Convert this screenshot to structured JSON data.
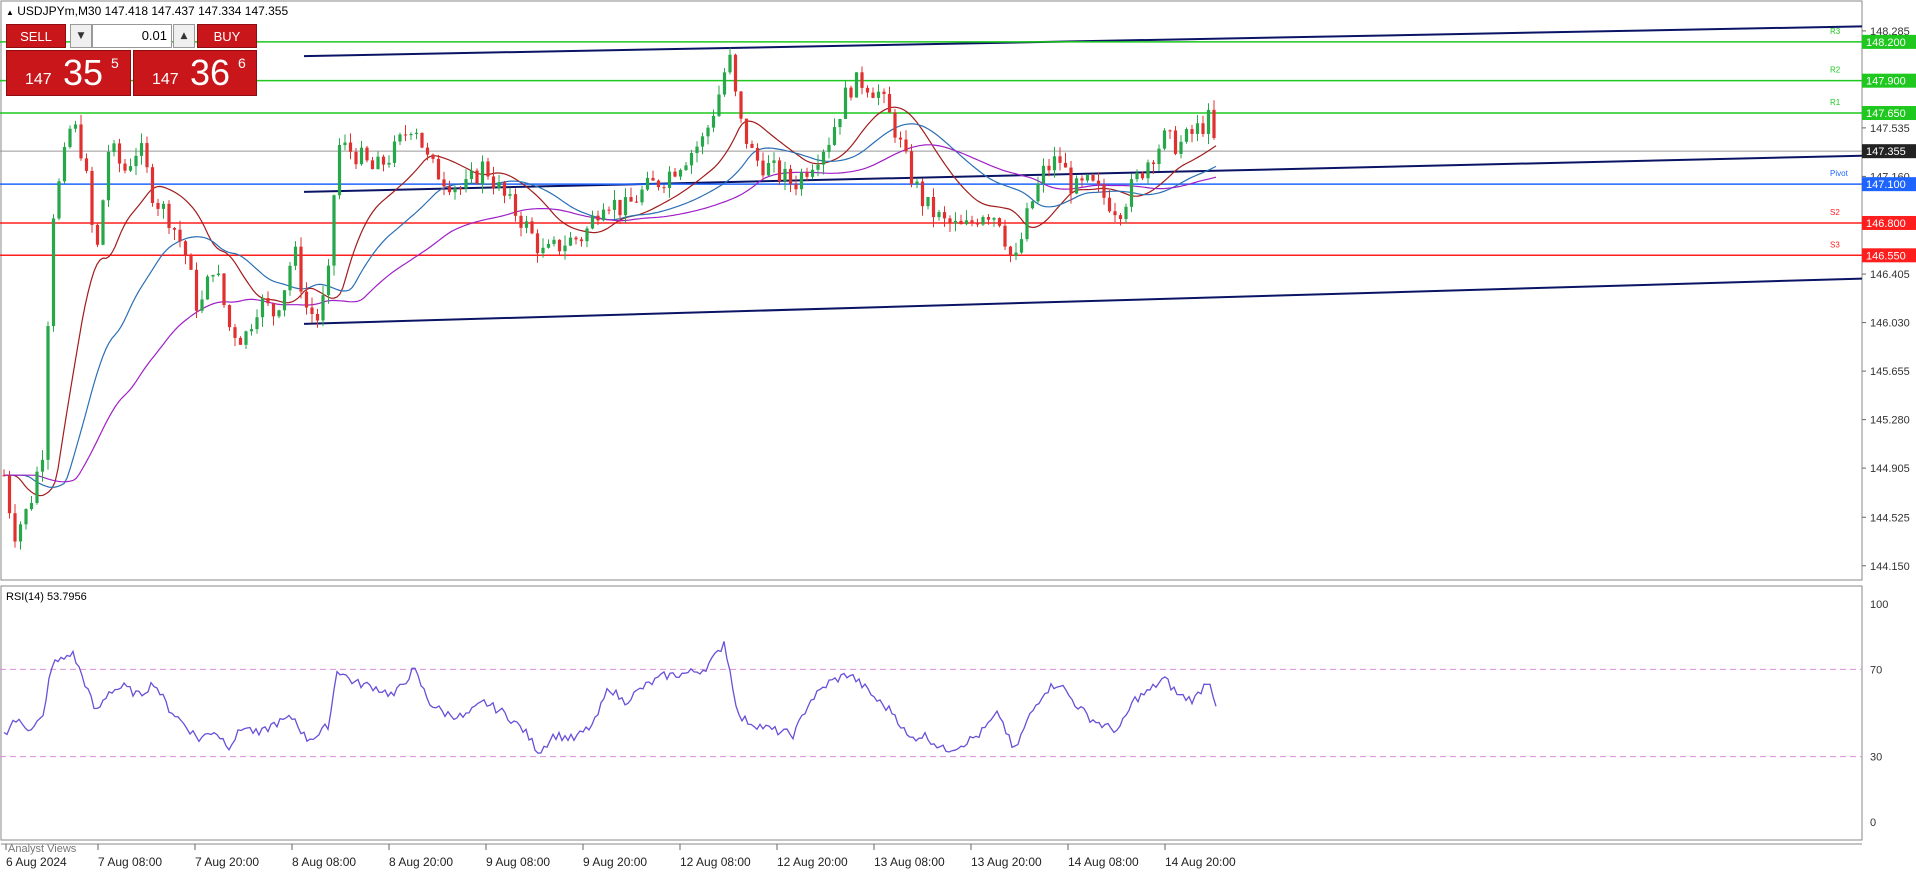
{
  "header": {
    "triangle": "▲",
    "symbol": "USDJPYm,M30",
    "ohlc": "147.418 147.437 147.334 147.355"
  },
  "trade_panel": {
    "sell_label": "SELL",
    "buy_label": "BUY",
    "lot": "0.01",
    "sell_price_small": "147",
    "sell_price_big": "35",
    "sell_price_sup": "5",
    "buy_price_small": "147",
    "buy_price_big": "36",
    "buy_price_sup": "6"
  },
  "rsi_label": "RSI(14) 53.7956",
  "analyst_label": "Analyst Views",
  "chart_data": {
    "type": "candlestick",
    "symbol": "USDJPYm",
    "timeframe": "M30",
    "y_ticks": [
      "148.285",
      "147.910",
      "147.535",
      "147.160",
      "146.785",
      "146.405",
      "146.030",
      "145.655",
      "145.280",
      "144.905",
      "144.525",
      "144.150"
    ],
    "ylim": [
      144.04,
      148.4
    ],
    "x_ticks": [
      "6 Aug 2024",
      "7 Aug 08:00",
      "7 Aug 20:00",
      "8 Aug 08:00",
      "8 Aug 20:00",
      "9 Aug 08:00",
      "9 Aug 20:00",
      "12 Aug 08:00",
      "12 Aug 20:00",
      "13 Aug 08:00",
      "13 Aug 20:00",
      "14 Aug 08:00",
      "14 Aug 20:00"
    ],
    "current_price": "147.355",
    "levels": [
      {
        "label": "R3",
        "price": 148.2,
        "text": "148.200",
        "color": "#1ec81e"
      },
      {
        "label": "R2",
        "price": 147.9,
        "text": "147.900",
        "color": "#1ec81e"
      },
      {
        "label": "R1",
        "price": 147.65,
        "text": "147.650",
        "color": "#1ec81e"
      },
      {
        "label": "Pivot",
        "price": 147.1,
        "text": "147.100",
        "color": "#1e64ff"
      },
      {
        "label": "S2",
        "price": 146.8,
        "text": "146.800",
        "color": "#ff1e1e"
      },
      {
        "label": "S3",
        "price": 146.55,
        "text": "146.550",
        "color": "#ff1e1e"
      }
    ],
    "keypoints": [
      {
        "x": 0,
        "p": 144.85
      },
      {
        "x": 10,
        "p": 144.4
      },
      {
        "x": 25,
        "p": 144.6
      },
      {
        "x": 40,
        "p": 145.1
      },
      {
        "x": 47,
        "p": 146.8
      },
      {
        "x": 58,
        "p": 147.2
      },
      {
        "x": 68,
        "p": 147.6
      },
      {
        "x": 80,
        "p": 147.3
      },
      {
        "x": 92,
        "p": 146.5
      },
      {
        "x": 105,
        "p": 147.4
      },
      {
        "x": 120,
        "p": 147.2
      },
      {
        "x": 135,
        "p": 147.4
      },
      {
        "x": 150,
        "p": 147.0
      },
      {
        "x": 165,
        "p": 146.85
      },
      {
        "x": 180,
        "p": 146.6
      },
      {
        "x": 195,
        "p": 146.1
      },
      {
        "x": 210,
        "p": 146.5
      },
      {
        "x": 225,
        "p": 146.0
      },
      {
        "x": 240,
        "p": 145.9
      },
      {
        "x": 255,
        "p": 146.2
      },
      {
        "x": 270,
        "p": 146.1
      },
      {
        "x": 280,
        "p": 146.3
      },
      {
        "x": 290,
        "p": 146.6
      },
      {
        "x": 302,
        "p": 146.15
      },
      {
        "x": 315,
        "p": 146.05
      },
      {
        "x": 325,
        "p": 146.4
      },
      {
        "x": 333,
        "p": 147.4
      },
      {
        "x": 350,
        "p": 147.35
      },
      {
        "x": 370,
        "p": 147.2
      },
      {
        "x": 390,
        "p": 147.35
      },
      {
        "x": 410,
        "p": 147.6
      },
      {
        "x": 425,
        "p": 147.25
      },
      {
        "x": 440,
        "p": 147.15
      },
      {
        "x": 460,
        "p": 147.05
      },
      {
        "x": 480,
        "p": 147.25
      },
      {
        "x": 500,
        "p": 147.0
      },
      {
        "x": 520,
        "p": 146.8
      },
      {
        "x": 540,
        "p": 146.55
      },
      {
        "x": 560,
        "p": 146.65
      },
      {
        "x": 580,
        "p": 146.7
      },
      {
        "x": 600,
        "p": 147.0
      },
      {
        "x": 620,
        "p": 146.9
      },
      {
        "x": 640,
        "p": 147.05
      },
      {
        "x": 660,
        "p": 147.15
      },
      {
        "x": 680,
        "p": 147.3
      },
      {
        "x": 700,
        "p": 147.45
      },
      {
        "x": 715,
        "p": 147.8
      },
      {
        "x": 725,
        "p": 148.1
      },
      {
        "x": 735,
        "p": 147.6
      },
      {
        "x": 750,
        "p": 147.3
      },
      {
        "x": 770,
        "p": 147.2
      },
      {
        "x": 790,
        "p": 147.1
      },
      {
        "x": 805,
        "p": 147.25
      },
      {
        "x": 825,
        "p": 147.45
      },
      {
        "x": 845,
        "p": 147.85
      },
      {
        "x": 860,
        "p": 147.9
      },
      {
        "x": 875,
        "p": 147.8
      },
      {
        "x": 890,
        "p": 147.55
      },
      {
        "x": 905,
        "p": 147.2
      },
      {
        "x": 920,
        "p": 146.95
      },
      {
        "x": 940,
        "p": 146.8
      },
      {
        "x": 960,
        "p": 146.75
      },
      {
        "x": 980,
        "p": 146.9
      },
      {
        "x": 995,
        "p": 146.85
      },
      {
        "x": 1010,
        "p": 146.45
      },
      {
        "x": 1025,
        "p": 146.9
      },
      {
        "x": 1040,
        "p": 147.2
      },
      {
        "x": 1055,
        "p": 147.3
      },
      {
        "x": 1070,
        "p": 147.05
      },
      {
        "x": 1085,
        "p": 147.1
      },
      {
        "x": 1100,
        "p": 147.0
      },
      {
        "x": 1115,
        "p": 146.9
      },
      {
        "x": 1130,
        "p": 147.1
      },
      {
        "x": 1145,
        "p": 147.3
      },
      {
        "x": 1160,
        "p": 147.45
      },
      {
        "x": 1175,
        "p": 147.4
      },
      {
        "x": 1190,
        "p": 147.5
      },
      {
        "x": 1205,
        "p": 147.6
      },
      {
        "x": 1212,
        "p": 147.355
      }
    ],
    "rsi": {
      "ylim": [
        0,
        100
      ],
      "ticks": [
        "100",
        "70",
        "30",
        "0"
      ],
      "levels": [
        70,
        30
      ],
      "keypoints": [
        {
          "x": 0,
          "v": 40
        },
        {
          "x": 10,
          "v": 47
        },
        {
          "x": 25,
          "v": 43
        },
        {
          "x": 40,
          "v": 48
        },
        {
          "x": 47,
          "v": 72
        },
        {
          "x": 60,
          "v": 75
        },
        {
          "x": 68,
          "v": 78
        },
        {
          "x": 80,
          "v": 65
        },
        {
          "x": 92,
          "v": 50
        },
        {
          "x": 105,
          "v": 60
        },
        {
          "x": 120,
          "v": 62
        },
        {
          "x": 135,
          "v": 58
        },
        {
          "x": 150,
          "v": 64
        },
        {
          "x": 165,
          "v": 52
        },
        {
          "x": 180,
          "v": 45
        },
        {
          "x": 195,
          "v": 38
        },
        {
          "x": 210,
          "v": 42
        },
        {
          "x": 225,
          "v": 35
        },
        {
          "x": 240,
          "v": 44
        },
        {
          "x": 255,
          "v": 40
        },
        {
          "x": 270,
          "v": 45
        },
        {
          "x": 290,
          "v": 48
        },
        {
          "x": 302,
          "v": 38
        },
        {
          "x": 315,
          "v": 40
        },
        {
          "x": 325,
          "v": 45
        },
        {
          "x": 333,
          "v": 70
        },
        {
          "x": 350,
          "v": 64
        },
        {
          "x": 370,
          "v": 62
        },
        {
          "x": 390,
          "v": 58
        },
        {
          "x": 410,
          "v": 70
        },
        {
          "x": 425,
          "v": 55
        },
        {
          "x": 440,
          "v": 50
        },
        {
          "x": 460,
          "v": 48
        },
        {
          "x": 480,
          "v": 55
        },
        {
          "x": 500,
          "v": 50
        },
        {
          "x": 520,
          "v": 42
        },
        {
          "x": 535,
          "v": 32
        },
        {
          "x": 550,
          "v": 40
        },
        {
          "x": 570,
          "v": 38
        },
        {
          "x": 590,
          "v": 45
        },
        {
          "x": 605,
          "v": 62
        },
        {
          "x": 620,
          "v": 55
        },
        {
          "x": 640,
          "v": 62
        },
        {
          "x": 660,
          "v": 67
        },
        {
          "x": 680,
          "v": 68
        },
        {
          "x": 700,
          "v": 70
        },
        {
          "x": 715,
          "v": 78
        },
        {
          "x": 720,
          "v": 83
        },
        {
          "x": 735,
          "v": 48
        },
        {
          "x": 750,
          "v": 45
        },
        {
          "x": 770,
          "v": 42
        },
        {
          "x": 790,
          "v": 40
        },
        {
          "x": 805,
          "v": 55
        },
        {
          "x": 825,
          "v": 64
        },
        {
          "x": 845,
          "v": 68
        },
        {
          "x": 860,
          "v": 62
        },
        {
          "x": 875,
          "v": 55
        },
        {
          "x": 890,
          "v": 50
        },
        {
          "x": 905,
          "v": 38
        },
        {
          "x": 920,
          "v": 40
        },
        {
          "x": 940,
          "v": 33
        },
        {
          "x": 955,
          "v": 35
        },
        {
          "x": 975,
          "v": 40
        },
        {
          "x": 995,
          "v": 50
        },
        {
          "x": 1010,
          "v": 32
        },
        {
          "x": 1025,
          "v": 48
        },
        {
          "x": 1040,
          "v": 60
        },
        {
          "x": 1055,
          "v": 64
        },
        {
          "x": 1070,
          "v": 55
        },
        {
          "x": 1085,
          "v": 48
        },
        {
          "x": 1100,
          "v": 44
        },
        {
          "x": 1115,
          "v": 42
        },
        {
          "x": 1130,
          "v": 56
        },
        {
          "x": 1145,
          "v": 60
        },
        {
          "x": 1160,
          "v": 66
        },
        {
          "x": 1175,
          "v": 58
        },
        {
          "x": 1190,
          "v": 56
        },
        {
          "x": 1205,
          "v": 66
        },
        {
          "x": 1212,
          "v": 54
        }
      ]
    }
  }
}
